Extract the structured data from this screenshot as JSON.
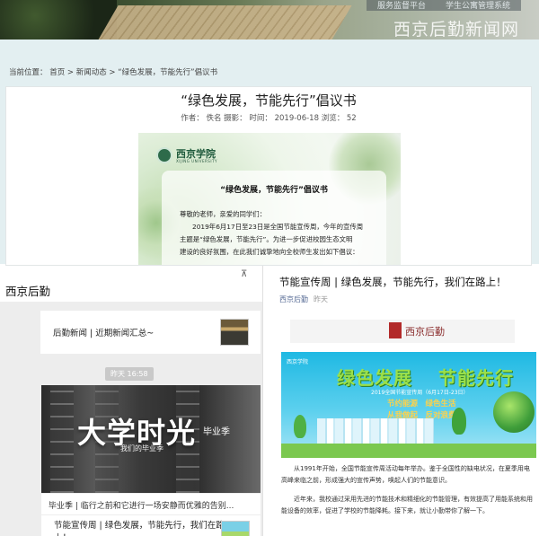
{
  "site": {
    "nav": [
      "服务监督平台",
      "学生公寓管理系统"
    ],
    "brand": "西京后勤新闻网"
  },
  "article": {
    "breadcrumb": "当前位置： 首页 > 新闻动态 > “绿色发展，节能先行”倡议书",
    "title": "“绿色发展，节能先行”倡议书",
    "meta": "作者： 佚名 摄影： 时间： 2019-06-18 浏览： 52",
    "poster": {
      "logo_text": "西京学院",
      "logo_sub": "XIJING UNIVERSITY",
      "heading": "“绿色发展，节能先行”倡议书",
      "greeting": "尊敬的老师，亲爱的同学们：",
      "lines": [
        "2019年6月17日至23日是全国节能宣传周，今年的宣传周",
        "主题是“绿色发展，节能先行”。为进一步促进校园生态文明",
        "建设的良好氛围，在此我们诚挚地向全校师生发出如下倡议："
      ]
    }
  },
  "wechat_list": {
    "account_name": "西京后勤",
    "pin_label": "⊼",
    "item1_title": "后勤新闻 | 近期新闻汇总~",
    "time_label": "昨天 16:58",
    "hero_big": "大学时光",
    "hero_sub": "我们的毕业季",
    "hero_season": "毕业季",
    "item2_title": "毕业季 | 临行之前和它进行一场安静而优雅的告别...",
    "item3_title": "节能宣传周 | 绿色发展，节能先行，我们在路上！"
  },
  "wx_article": {
    "title": "节能宣传周 | 绿色发展，节能先行，我们在路上！",
    "source": "西京后勤",
    "date": "昨天",
    "logo_text": "西京后勤",
    "poster": {
      "logo": "西京学院",
      "heading_left": "绿色发展",
      "heading_right": "节能先行",
      "date_line": "2019全国节能宣传周（6月17日-23日）",
      "slogan_1": "节约能源　绿色生活",
      "slogan_2": "从我做起　反对浪费"
    },
    "body": [
      "从1991年开始，全国节能宣传周活动每年举办。鉴于全国性的缺电状况，在夏季用电高峰来临之前，形成强大的宣传声势，唤起人们的节能意识。",
      "近年来，我校通过采用先进的节能技术和精细化的节能管理，有效提高了用能系统和用能设备的效率，促进了学校的节能降耗。接下来，就让小勤带你了解一下。"
    ]
  }
}
